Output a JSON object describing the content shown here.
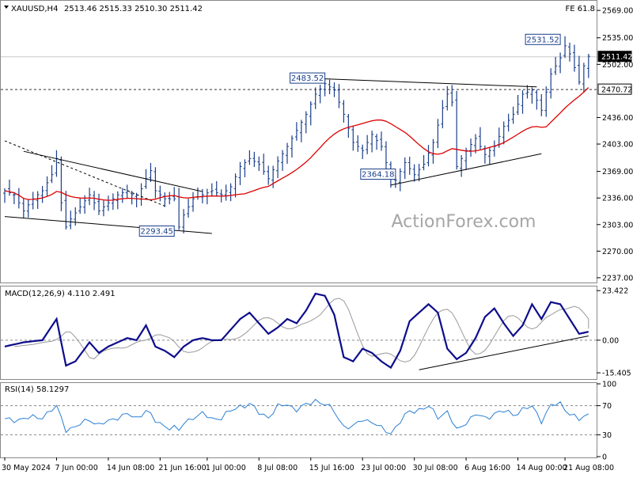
{
  "header": {
    "symbol": "XAUUSD,H4",
    "ohlc": "2513.46 2515.33 2510.30 2511.42",
    "fe_label": "FE 61.8"
  },
  "watermark": "ActionForex.com",
  "colors": {
    "price_bars": "#1a3e8c",
    "sma": "#dd0000",
    "macd": "#0d0d8c",
    "signal": "#999999",
    "rsi": "#2a7fd4",
    "trendline": "#000000",
    "grid_dashed": "#888888"
  },
  "chart_data": [
    {
      "type": "ohlc",
      "name": "price",
      "y_ticks": [
        "2569.00",
        "2535.00",
        "2502.00",
        "2436.00",
        "2403.00",
        "2369.00",
        "2336.00",
        "2303.00",
        "2270.00",
        "2237.00"
      ],
      "ylim": [
        2232,
        2578
      ],
      "current_price": "2511.42",
      "horizontal_level": "2470.72",
      "moving_average": "red line",
      "annotations": [
        {
          "label": "2531.52",
          "value": 2531.52,
          "x": 118
        },
        {
          "label": "2483.52",
          "value": 2483.52,
          "x": 68
        },
        {
          "label": "2364.18",
          "value": 2364.18,
          "x": 83
        },
        {
          "label": "2293.45",
          "value": 2293.45,
          "x": 36
        }
      ],
      "close_waypoints": [
        [
          0,
          2345
        ],
        [
          2,
          2340
        ],
        [
          4,
          2320
        ],
        [
          6,
          2335
        ],
        [
          8,
          2345
        ],
        [
          10,
          2365
        ],
        [
          11,
          2385
        ],
        [
          12,
          2330
        ],
        [
          13,
          2300
        ],
        [
          14,
          2310
        ],
        [
          16,
          2325
        ],
        [
          18,
          2340
        ],
        [
          20,
          2320
        ],
        [
          22,
          2330
        ],
        [
          24,
          2340
        ],
        [
          26,
          2345
        ],
        [
          28,
          2335
        ],
        [
          30,
          2360
        ],
        [
          31,
          2370
        ],
        [
          32,
          2345
        ],
        [
          34,
          2335
        ],
        [
          36,
          2335
        ],
        [
          37,
          2300
        ],
        [
          38,
          2315
        ],
        [
          40,
          2335
        ],
        [
          42,
          2340
        ],
        [
          44,
          2345
        ],
        [
          46,
          2340
        ],
        [
          48,
          2350
        ],
        [
          50,
          2375
        ],
        [
          52,
          2385
        ],
        [
          54,
          2378
        ],
        [
          56,
          2360
        ],
        [
          58,
          2382
        ],
        [
          60,
          2400
        ],
        [
          62,
          2420
        ],
        [
          64,
          2440
        ],
        [
          66,
          2465
        ],
        [
          68,
          2478
        ],
        [
          70,
          2470
        ],
        [
          72,
          2440
        ],
        [
          74,
          2405
        ],
        [
          76,
          2395
        ],
        [
          78,
          2415
        ],
        [
          80,
          2400
        ],
        [
          82,
          2360
        ],
        [
          83,
          2358
        ],
        [
          85,
          2380
        ],
        [
          87,
          2365
        ],
        [
          89,
          2378
        ],
        [
          91,
          2405
        ],
        [
          93,
          2448
        ],
        [
          94,
          2465
        ],
        [
          95,
          2455
        ],
        [
          96,
          2375
        ],
        [
          98,
          2395
        ],
        [
          100,
          2410
        ],
        [
          102,
          2390
        ],
        [
          104,
          2400
        ],
        [
          106,
          2425
        ],
        [
          108,
          2440
        ],
        [
          110,
          2465
        ],
        [
          112,
          2470
        ],
        [
          114,
          2445
        ],
        [
          116,
          2490
        ],
        [
          118,
          2510
        ],
        [
          119,
          2525
        ],
        [
          120,
          2515
        ],
        [
          121,
          2498
        ],
        [
          122,
          2480
        ],
        [
          123,
          2500
        ],
        [
          124,
          2512
        ]
      ],
      "trendlines": [
        {
          "from": [
            4,
            2394
          ],
          "to": [
            42,
            2344
          ]
        },
        {
          "from": [
            0,
            2313
          ],
          "to": [
            44,
            2292
          ]
        },
        {
          "from": [
            0,
            2407
          ],
          "to": [
            34,
            2326
          ],
          "style": "dashed"
        },
        {
          "from": [
            68,
            2484
          ],
          "to": [
            113,
            2474
          ]
        },
        {
          "from": [
            82,
            2352
          ],
          "to": [
            114,
            2391
          ]
        }
      ]
    },
    {
      "type": "line",
      "name": "MACD(12,26,9)",
      "label": "MACD(12,26,9) 4.110 2.491",
      "y_ticks": [
        "23.422",
        "0.00",
        "-15.405"
      ],
      "ylim": [
        -18,
        25
      ],
      "series": [
        {
          "name": "MACD",
          "waypoints": [
            [
              0,
              -3
            ],
            [
              4,
              -1
            ],
            [
              8,
              0
            ],
            [
              11,
              10
            ],
            [
              13,
              -12
            ],
            [
              15,
              -10
            ],
            [
              18,
              -1
            ],
            [
              20,
              -6
            ],
            [
              22,
              -3
            ],
            [
              24,
              -1
            ],
            [
              26,
              1
            ],
            [
              28,
              0
            ],
            [
              30,
              7
            ],
            [
              32,
              -3
            ],
            [
              34,
              -5
            ],
            [
              36,
              -8
            ],
            [
              38,
              -3
            ],
            [
              40,
              0
            ],
            [
              42,
              1
            ],
            [
              44,
              0
            ],
            [
              46,
              0
            ],
            [
              48,
              5
            ],
            [
              50,
              10
            ],
            [
              52,
              13
            ],
            [
              54,
              8
            ],
            [
              56,
              3
            ],
            [
              58,
              6
            ],
            [
              60,
              10
            ],
            [
              62,
              8
            ],
            [
              64,
              14
            ],
            [
              66,
              22
            ],
            [
              68,
              21
            ],
            [
              70,
              12
            ],
            [
              72,
              -8
            ],
            [
              74,
              -10
            ],
            [
              76,
              -4
            ],
            [
              78,
              -6
            ],
            [
              80,
              -10
            ],
            [
              82,
              -13
            ],
            [
              84,
              -5
            ],
            [
              86,
              9
            ],
            [
              88,
              13
            ],
            [
              90,
              17
            ],
            [
              92,
              13
            ],
            [
              94,
              -4
            ],
            [
              96,
              -9
            ],
            [
              98,
              -6
            ],
            [
              100,
              1
            ],
            [
              102,
              11
            ],
            [
              104,
              15
            ],
            [
              106,
              8
            ],
            [
              108,
              2
            ],
            [
              110,
              7
            ],
            [
              112,
              17
            ],
            [
              114,
              10
            ],
            [
              116,
              18
            ],
            [
              118,
              17
            ],
            [
              120,
              10
            ],
            [
              122,
              3
            ],
            [
              124,
              4
            ]
          ]
        },
        {
          "name": "Signal",
          "lag": 2
        }
      ],
      "trendline": {
        "from": [
          88,
          -14
        ],
        "to": [
          124,
          2
        ]
      }
    },
    {
      "type": "line",
      "name": "RSI(14)",
      "label": "RSI(14) 58.1297",
      "y_ticks": [
        "100",
        "70",
        "30",
        "0"
      ],
      "ylim": [
        0,
        100
      ],
      "levels": [
        70,
        30
      ],
      "waypoints": [
        [
          0,
          50
        ],
        [
          4,
          52
        ],
        [
          8,
          55
        ],
        [
          11,
          68
        ],
        [
          13,
          38
        ],
        [
          15,
          40
        ],
        [
          18,
          52
        ],
        [
          20,
          43
        ],
        [
          22,
          48
        ],
        [
          24,
          55
        ],
        [
          26,
          58
        ],
        [
          28,
          52
        ],
        [
          30,
          65
        ],
        [
          32,
          48
        ],
        [
          34,
          42
        ],
        [
          36,
          40
        ],
        [
          37,
          35
        ],
        [
          38,
          45
        ],
        [
          40,
          55
        ],
        [
          42,
          58
        ],
        [
          44,
          52
        ],
        [
          46,
          54
        ],
        [
          48,
          62
        ],
        [
          50,
          70
        ],
        [
          52,
          72
        ],
        [
          54,
          60
        ],
        [
          56,
          55
        ],
        [
          58,
          68
        ],
        [
          60,
          72
        ],
        [
          62,
          65
        ],
        [
          64,
          70
        ],
        [
          66,
          78
        ],
        [
          68,
          72
        ],
        [
          70,
          62
        ],
        [
          72,
          42
        ],
        [
          74,
          40
        ],
        [
          76,
          52
        ],
        [
          78,
          48
        ],
        [
          80,
          38
        ],
        [
          82,
          33
        ],
        [
          84,
          48
        ],
        [
          86,
          62
        ],
        [
          88,
          65
        ],
        [
          90,
          68
        ],
        [
          92,
          55
        ],
        [
          94,
          62
        ],
        [
          96,
          35
        ],
        [
          98,
          48
        ],
        [
          100,
          58
        ],
        [
          102,
          52
        ],
        [
          104,
          60
        ],
        [
          106,
          62
        ],
        [
          108,
          58
        ],
        [
          110,
          65
        ],
        [
          112,
          68
        ],
        [
          114,
          50
        ],
        [
          116,
          70
        ],
        [
          118,
          72
        ],
        [
          120,
          60
        ],
        [
          122,
          50
        ],
        [
          124,
          58
        ]
      ]
    }
  ],
  "x_axis": {
    "labels": [
      "30 May 2024",
      "7 Jun 00:00",
      "14 Jun 08:00",
      "21 Jun 16:00",
      "1 Jul 00:00",
      "8 Jul 08:00",
      "15 Jul 16:00",
      "23 Jul 00:00",
      "30 Jul 08:00",
      "6 Aug 16:00",
      "14 Aug 00:00",
      "21 Aug 08:00"
    ],
    "label_bar": [
      0,
      11,
      22,
      33,
      43,
      54,
      65,
      76,
      87,
      98,
      109,
      119
    ]
  }
}
